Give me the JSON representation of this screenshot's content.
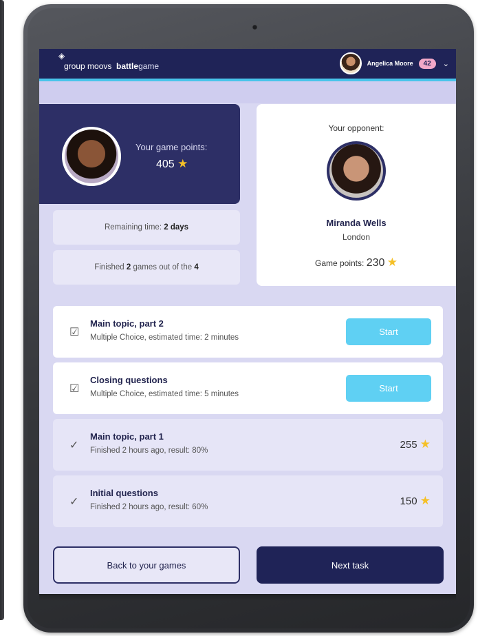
{
  "header": {
    "logo_prefix": "group moovs",
    "logo_bold": "battle",
    "logo_suffix": "game",
    "user_name": "Angelica Moore",
    "notification_count": "42",
    "dropdown_icon": "chevron-down-icon"
  },
  "player": {
    "points_label": "Your game points:",
    "points_value": "405",
    "remaining_prefix": "Remaining time:",
    "remaining_value": "2 days",
    "finished_prefix": "Finished",
    "finished_count": "2",
    "finished_middle": "games out of the",
    "finished_total": "4"
  },
  "opponent": {
    "label": "Your opponent:",
    "name": "Miranda Wells",
    "city": "London",
    "points_label": "Game points:",
    "points_value": "230"
  },
  "tasks": [
    {
      "title": "Main topic, part 2",
      "subtitle": "Multiple Choice, estimated time: 2 minutes",
      "status": "active",
      "button_label": "Start",
      "icon": "checklist-icon"
    },
    {
      "title": "Closing questions",
      "subtitle": "Multiple Choice, estimated time: 5 minutes",
      "status": "active",
      "button_label": "Start",
      "icon": "checklist-icon"
    },
    {
      "title": "Main topic, part 1",
      "subtitle": "Finished 2 hours ago, result: 80%",
      "status": "done",
      "score": "255",
      "icon": "check-icon"
    },
    {
      "title": "Initial questions",
      "subtitle": "Finished 2 hours ago, result: 60%",
      "status": "done",
      "score": "150",
      "icon": "check-icon"
    }
  ],
  "footer": {
    "back_label": "Back to your games",
    "next_label": "Next task"
  },
  "colors": {
    "navy": "#1f2357",
    "panel": "#2d2f66",
    "accent_cyan": "#5fd0f3",
    "background": "#d9d8f2",
    "star": "#f5c027"
  }
}
